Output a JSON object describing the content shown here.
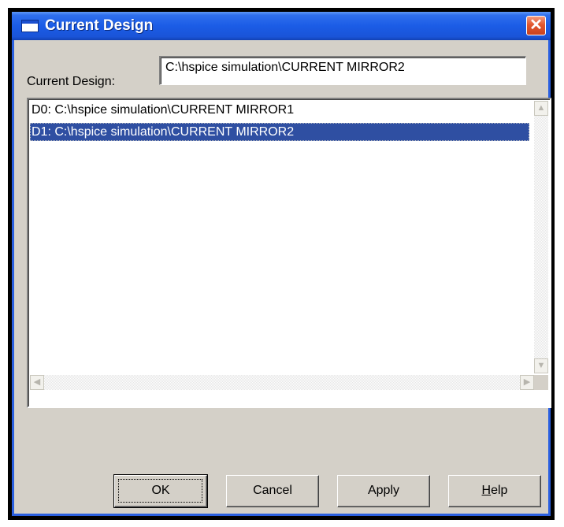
{
  "window": {
    "title": "Current Design",
    "close_label": "✕"
  },
  "form": {
    "current_design_label": "Current Design:",
    "current_design_value": "C:\\hspice simulation\\CURRENT MIRROR2"
  },
  "design_list": {
    "items": [
      {
        "label": "D0: C:\\hspice simulation\\CURRENT MIRROR1",
        "selected": false
      },
      {
        "label": "D1: C:\\hspice simulation\\CURRENT MIRROR2",
        "selected": true
      }
    ]
  },
  "scrollbar": {
    "up_icon": "▲",
    "down_icon": "▼",
    "left_icon": "◀",
    "right_icon": "▶"
  },
  "buttons": {
    "ok": "OK",
    "cancel": "Cancel",
    "apply": "Apply",
    "help_mnemonic": "H",
    "help_rest": "elp"
  },
  "colors": {
    "titlebar": "#1b5ce6",
    "selection": "#2f4fa2",
    "dialog_face": "#d4d0c8"
  }
}
